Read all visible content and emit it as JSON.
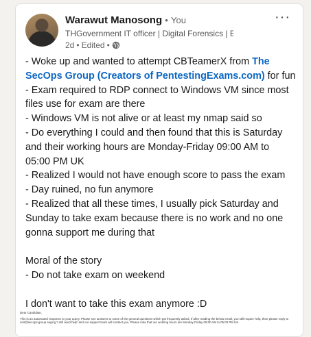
{
  "post": {
    "author": "Warawut Manosong",
    "separator": "•",
    "you_label": "You",
    "headline": "THGovernment IT officer | Digital Forensics | Blue Tea...",
    "time": "2d",
    "edited": "Edited",
    "more": "···",
    "intro_text": "- Woke up and wanted to attempt CBTeamerX from ",
    "intro_link": "The SecOps Group (Creators of PentestingExams.com)",
    "intro_suffix": " for fun",
    "lines": [
      "- Exam required to RDP connect to Windows VM since most files use for exam are there",
      "- Windows VM is not alive or at least my nmap said so",
      "- Do everything I could and then found that this is Saturday and their working hours are Monday-Friday 09:00 AM to 05:00 PM UK",
      "- Realized I would not have enough score to pass the exam",
      "- Day ruined, no fun anymore",
      "- Realized that all these times, I usually pick Saturday and Sunday to take exam because there is no work and no one gonna support me during that"
    ],
    "moral_title": "Moral of the story",
    "moral_line": "- Do not take exam on weekend",
    "closing": "I don't want to take this exam anymore :D"
  },
  "attachment": {
    "greeting": "Dear Candidate,",
    "body": "This is an automated response to your query. Please see answers to some of the general questions which get frequently asked. If after reading the below email, you still require help, then please reply to cert@secops.group saying 'I still need help' and our support team will contact you. Please note that our working hours are Monday Friday 09:00 AM to 05:00 PM UK."
  }
}
